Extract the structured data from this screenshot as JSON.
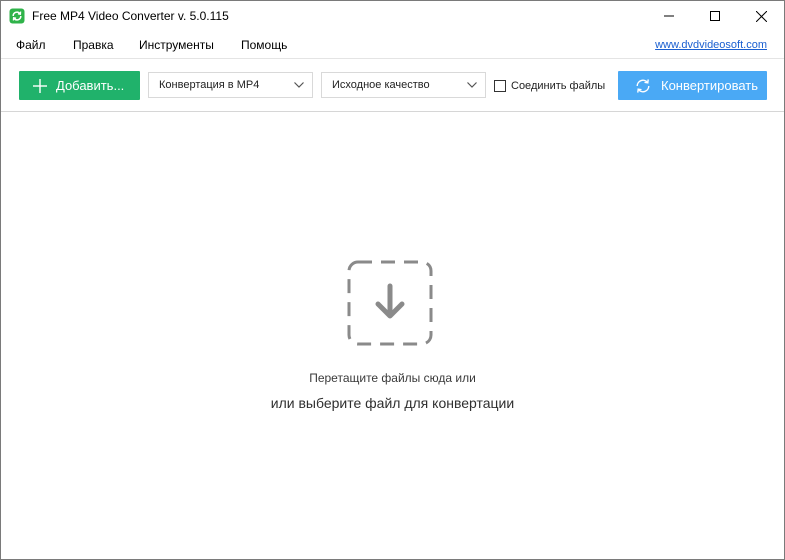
{
  "window": {
    "title": "Free MP4 Video Converter v. 5.0.115",
    "controls": [
      "minimize-icon",
      "maximize-icon",
      "close-icon"
    ]
  },
  "menu": {
    "items": [
      {
        "label": "Файл"
      },
      {
        "label": "Правка"
      },
      {
        "label": "Инструменты"
      },
      {
        "label": "Помощь"
      }
    ],
    "site_link": "www.dvdvideosoft.com"
  },
  "toolbar": {
    "add_label": "Добавить...",
    "format_select": "Конвертация в MP4",
    "quality_select": "Исходное качество",
    "join_files_label": "Соединить файлы",
    "join_files_checked": false,
    "convert_label": "Конвертировать"
  },
  "dropzone": {
    "icon": "download-arrow-icon",
    "line1": "Перетащите файлы сюда или",
    "line2": "или выберите файл для конвертации"
  },
  "colors": {
    "add_button": "#20b26b",
    "convert_button": "#4aa9f5",
    "link": "#1a5fd0",
    "drop_icon": "#8a8a8a"
  }
}
